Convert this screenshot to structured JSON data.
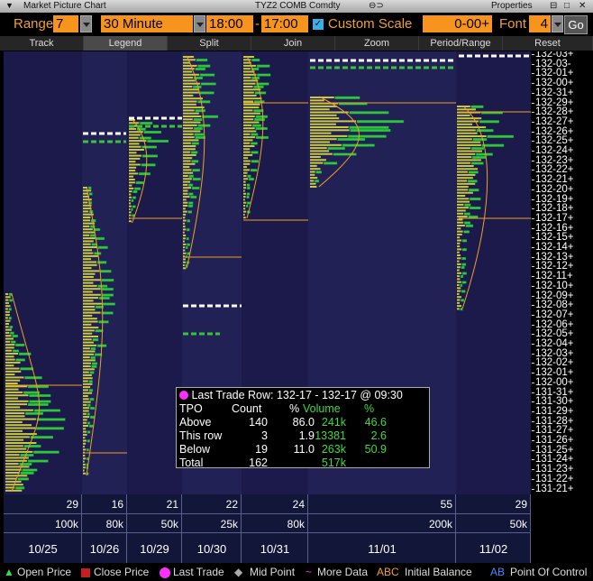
{
  "window": {
    "title": "Market Picture Chart",
    "security": "TYZ2 COMB Comdty",
    "properties": "Properties"
  },
  "toolbar": {
    "range_label": "Range",
    "range_value": "7",
    "interval_value": "30 Minute",
    "start_time": "18:00",
    "end_time": "17:00",
    "custom_scale_label": "Custom Scale",
    "custom_scale_checked": true,
    "scale_value": "0-00+",
    "font_label": "Font",
    "font_value": "4",
    "go_label": "Go"
  },
  "menu": [
    "Track",
    "Legend",
    "Split",
    "Join",
    "Zoom",
    "Period/Range",
    "Reset"
  ],
  "price_axis": [
    "132-03+",
    "132-03-",
    "132-01+",
    "132-00+",
    "132-31+",
    "132-29+",
    "132-28+",
    "132-27+",
    "132-26+",
    "132-25+",
    "132-24+",
    "132-23+",
    "132-22+",
    "132-21+",
    "132-20+",
    "132-19+",
    "132-18+",
    "132-17+",
    "132-16+",
    "132-15+",
    "132-14+",
    "132-13+",
    "132-12+",
    "132-11+",
    "132-10+",
    "132-09+",
    "132-08+",
    "132-07+",
    "132-06+",
    "132-05+",
    "132-04+",
    "132-03+",
    "132-02+",
    "132-01+",
    "132-00+",
    "131-31+",
    "131-30+",
    "131-29+",
    "131-28+",
    "131-27+",
    "131-26+",
    "131-25+",
    "131-24+",
    "131-23+",
    "131-22+",
    "131-21+"
  ],
  "sessions": [
    {
      "date": "10/25",
      "tpo": "29",
      "volume": "100k"
    },
    {
      "date": "10/26",
      "tpo": "16",
      "volume": "80k"
    },
    {
      "date": "10/29",
      "tpo": "21",
      "volume": "50k"
    },
    {
      "date": "10/30",
      "tpo": "22",
      "volume": "25k"
    },
    {
      "date": "10/31",
      "tpo": "24",
      "volume": "80k"
    },
    {
      "date": "11/01",
      "tpo": "55",
      "volume": "200k"
    },
    {
      "date": "11/02",
      "tpo": "29",
      "volume": "50k"
    }
  ],
  "stats": {
    "header": "Last Trade Row:  132-17 - 132-17 @  09:30",
    "cols": [
      "TPO",
      "Count",
      "%",
      "Volume",
      "%"
    ],
    "rows": [
      {
        "label": "Above",
        "count": "140",
        "pct": "86.0",
        "volume": "241k",
        "vpct": "46.6"
      },
      {
        "label": "This row",
        "count": "3",
        "pct": "1.9",
        "volume": "13381",
        "vpct": "2.6"
      },
      {
        "label": "Below",
        "count": "19",
        "pct": "11.0",
        "volume": "263k",
        "vpct": "50.9"
      },
      {
        "label": "Total",
        "count": "162",
        "pct": "",
        "volume": "517k",
        "vpct": ""
      }
    ]
  },
  "legend": {
    "open": "Open Price",
    "close": "Close Price",
    "last": "Last Trade",
    "mid": "Mid Point",
    "more_abbr": "~",
    "more": "More Data",
    "ib_abbr": "ABC",
    "ib": "Initial Balance",
    "poc_abbr": "AB",
    "poc": "Point Of Control"
  },
  "colors": {
    "accent": "#f7941d",
    "chart_bg": "#1b1a4a",
    "profile": "#e8e840",
    "volume": "#39c23a",
    "vwap": "#f0a020"
  }
}
